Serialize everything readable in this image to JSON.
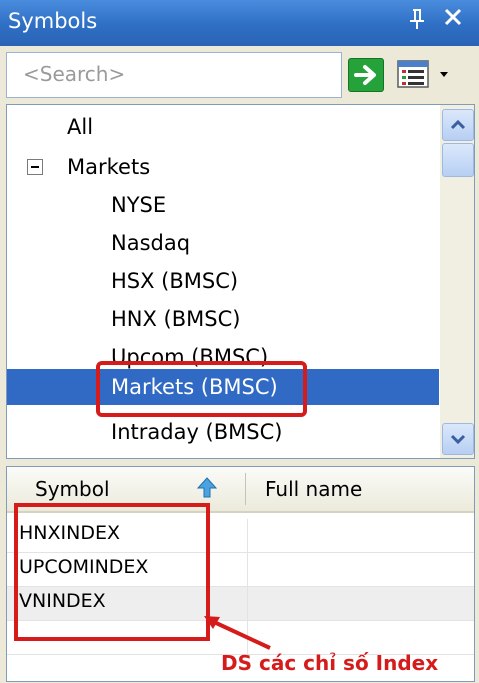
{
  "window": {
    "title": "Symbols",
    "pin_glyph": "p",
    "close_glyph": "✕"
  },
  "search": {
    "placeholder": "<Search>",
    "go_icon": "arrow-right-icon",
    "menu_icon": "list-menu-icon"
  },
  "tree": {
    "items": [
      {
        "label": "All",
        "level": 0
      },
      {
        "label": "Markets",
        "level": 0,
        "expanded": true
      },
      {
        "label": "NYSE",
        "level": 1
      },
      {
        "label": "Nasdaq",
        "level": 1
      },
      {
        "label": "HSX (BMSC)",
        "level": 1
      },
      {
        "label": "HNX (BMSC)",
        "level": 1
      },
      {
        "label": "Upcom (BMSC)",
        "level": 1
      },
      {
        "label": "Markets (BMSC)",
        "level": 1,
        "selected": true
      },
      {
        "label": "Intraday (BMSC)",
        "level": 1
      }
    ]
  },
  "grid": {
    "columns": [
      "Symbol",
      "Full name"
    ],
    "rows": [
      {
        "symbol": "HNXINDEX",
        "full_name": ""
      },
      {
        "symbol": "UPCOMINDEX",
        "full_name": ""
      },
      {
        "symbol": "VNINDEX",
        "full_name": ""
      }
    ]
  },
  "annotation": {
    "text": "DS các chỉ số Index",
    "color": "#d61b1b"
  },
  "colors": {
    "titlebar": "#2e6fc4",
    "selection": "#316ac5",
    "panel": "#ece9d8"
  }
}
